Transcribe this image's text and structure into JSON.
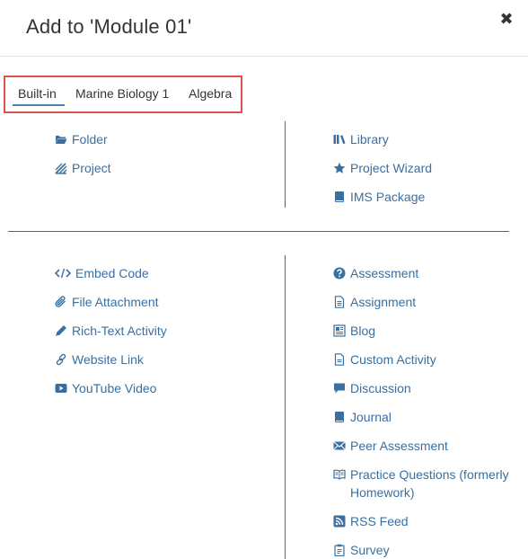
{
  "modal": {
    "title": "Add to 'Module 01'",
    "close_symbol": "✖"
  },
  "tabs": [
    {
      "label": "Built-in",
      "active": true
    },
    {
      "label": "Marine Biology 1",
      "active": false
    },
    {
      "label": "Algebra",
      "active": false
    }
  ],
  "top_left": [
    {
      "label": "Folder",
      "icon": "folder-open-icon"
    },
    {
      "label": "Project",
      "icon": "project-icon"
    }
  ],
  "top_right": [
    {
      "label": "Library",
      "icon": "library-icon"
    },
    {
      "label": "Project Wizard",
      "icon": "star-icon"
    },
    {
      "label": "IMS Package",
      "icon": "book-icon"
    }
  ],
  "bottom_left": [
    {
      "label": "Embed Code",
      "icon": "code-icon"
    },
    {
      "label": "File Attachment",
      "icon": "paperclip-icon"
    },
    {
      "label": "Rich-Text Activity",
      "icon": "pencil-icon"
    },
    {
      "label": "Website Link",
      "icon": "link-icon"
    },
    {
      "label": "YouTube Video",
      "icon": "youtube-icon"
    }
  ],
  "bottom_right": [
    {
      "label": "Assessment",
      "icon": "question-circle-icon"
    },
    {
      "label": "Assignment",
      "icon": "file-text-icon"
    },
    {
      "label": "Blog",
      "icon": "newspaper-icon"
    },
    {
      "label": "Custom Activity",
      "icon": "file-icon"
    },
    {
      "label": "Discussion",
      "icon": "comment-icon"
    },
    {
      "label": "Journal",
      "icon": "journal-icon"
    },
    {
      "label": "Peer Assessment",
      "icon": "envelope-icon"
    },
    {
      "label": "Practice Questions (formerly Homework)",
      "icon": "open-book-icon"
    },
    {
      "label": "RSS Feed",
      "icon": "rss-icon"
    },
    {
      "label": "Survey",
      "icon": "clipboard-icon"
    }
  ],
  "colors": {
    "link": "#3a6fa0",
    "tab_highlight_border": "#d9534f",
    "divider": "#3a6fa0"
  }
}
